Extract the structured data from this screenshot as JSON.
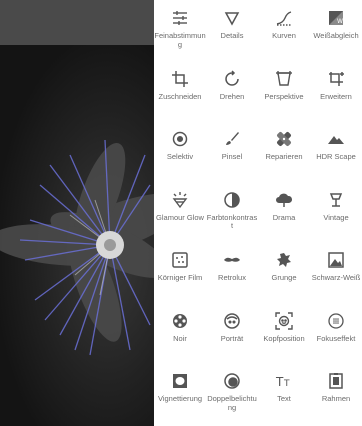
{
  "tools": [
    {
      "label": "Feinabstimmung",
      "icon": "tune-sliders-icon"
    },
    {
      "label": "Details",
      "icon": "details-triangle-icon"
    },
    {
      "label": "Kurven",
      "icon": "curves-icon"
    },
    {
      "label": "Weißabgleich",
      "icon": "white-balance-icon"
    },
    {
      "label": "Zuschneiden",
      "icon": "crop-icon"
    },
    {
      "label": "Drehen",
      "icon": "rotate-icon"
    },
    {
      "label": "Perspektive",
      "icon": "perspective-icon"
    },
    {
      "label": "Erweitern",
      "icon": "expand-icon"
    },
    {
      "label": "Selektiv",
      "icon": "selective-target-icon"
    },
    {
      "label": "Pinsel",
      "icon": "brush-icon"
    },
    {
      "label": "Reparieren",
      "icon": "healing-bandage-icon"
    },
    {
      "label": "HDR Scape",
      "icon": "mountains-icon"
    },
    {
      "label": "Glamour Glow",
      "icon": "glamour-glow-icon"
    },
    {
      "label": "Farbtonkontrast",
      "icon": "tonal-contrast-icon"
    },
    {
      "label": "Drama",
      "icon": "cloud-icon"
    },
    {
      "label": "Vintage",
      "icon": "lamp-icon"
    },
    {
      "label": "Körniger Film",
      "icon": "grainy-film-icon"
    },
    {
      "label": "Retrolux",
      "icon": "mustache-icon"
    },
    {
      "label": "Grunge",
      "icon": "grunge-icon"
    },
    {
      "label": "Schwarz-Weiß",
      "icon": "black-white-icon"
    },
    {
      "label": "Noir",
      "icon": "film-reel-icon"
    },
    {
      "label": "Porträt",
      "icon": "face-icon"
    },
    {
      "label": "Kopfposition",
      "icon": "head-pose-icon"
    },
    {
      "label": "Fokuseffekt",
      "icon": "focus-effect-icon"
    },
    {
      "label": "Vignettierung",
      "icon": "vignette-icon"
    },
    {
      "label": "Doppelbelichtung",
      "icon": "double-exposure-icon"
    },
    {
      "label": "Text",
      "icon": "text-icon"
    },
    {
      "label": "Rahmen",
      "icon": "frame-icon"
    }
  ]
}
